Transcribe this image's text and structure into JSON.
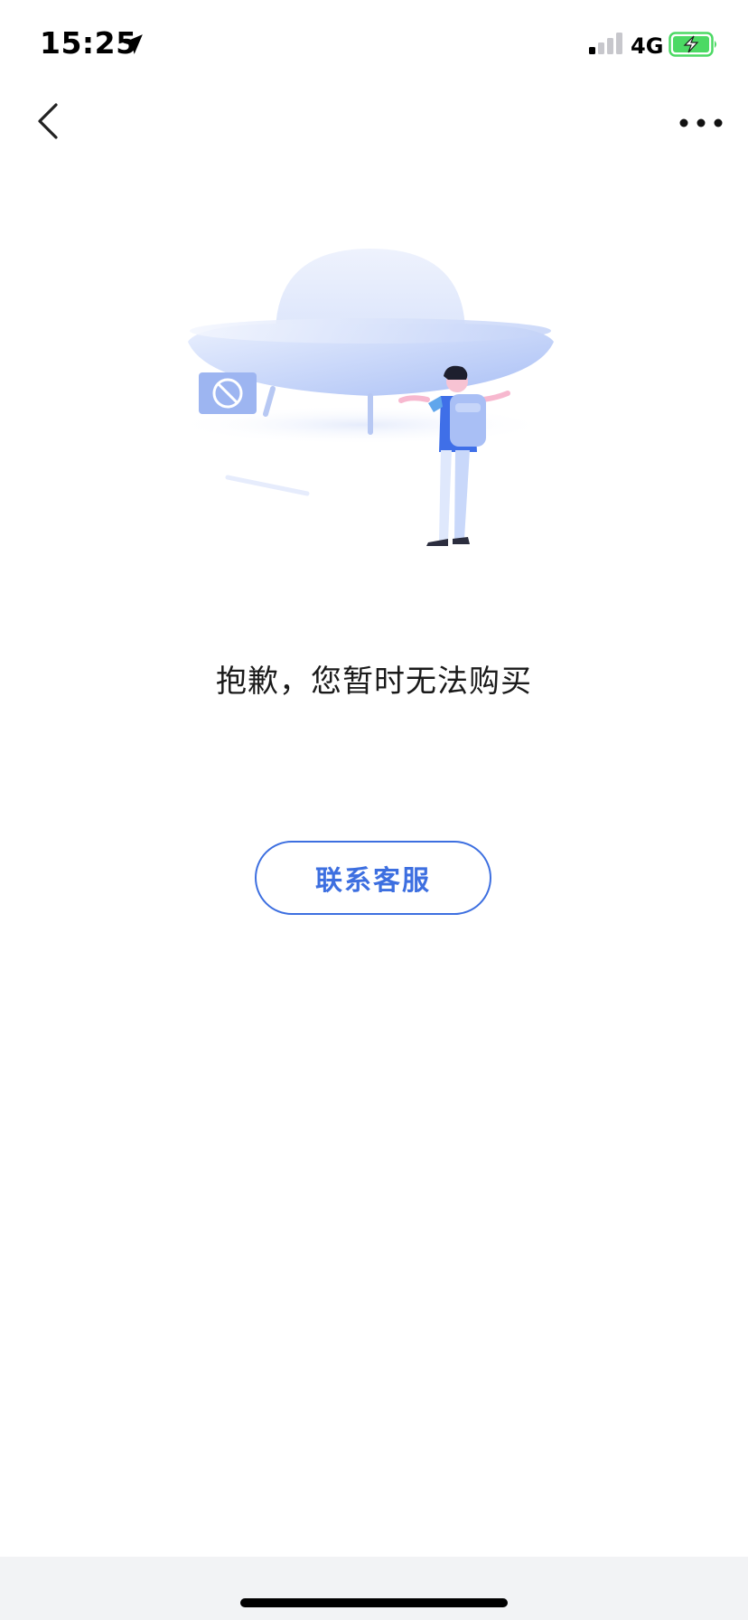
{
  "status_bar": {
    "time": "15:25",
    "network": "4G",
    "icons": [
      "location-arrow-icon",
      "cellular-signal-icon",
      "battery-charging-icon"
    ],
    "battery_color": "#4cd964"
  },
  "nav": {
    "back_icon": "chevron-left-icon",
    "more_icon": "more-dots-icon"
  },
  "illustration": {
    "subject": "ufo-with-person-and-prohibition-sign"
  },
  "message": {
    "text": "抱歉，您暂时无法购买"
  },
  "contact_button": {
    "label": "联系客服"
  },
  "colors": {
    "accent": "#3d6fe0",
    "background": "#ffffff",
    "bottom_bar": "#f2f3f5"
  }
}
